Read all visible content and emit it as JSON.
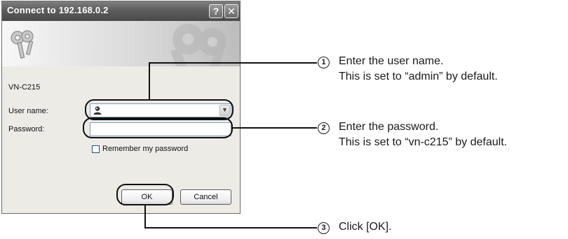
{
  "dialog": {
    "title": "Connect to 192.168.0.2",
    "help_glyph": "?",
    "close_glyph": "✕",
    "server_name": "VN-C215",
    "user_label": "User name:",
    "user_value": "",
    "password_label": "Password:",
    "password_value": "",
    "remember_label": "Remember my password",
    "remember_checked": false,
    "ok_label": "OK",
    "cancel_label": "Cancel"
  },
  "icons": {
    "banner": "keys-icon",
    "user": "user-icon",
    "dropdown": "chevron-down-icon"
  },
  "callouts": [
    {
      "number": "1",
      "line1": "Enter the user name.",
      "line2": "This is set to “admin” by default."
    },
    {
      "number": "2",
      "line1": "Enter the password.",
      "line2": "This is set to “vn-c215” by default."
    },
    {
      "number": "3",
      "line1": "Click [OK].",
      "line2": ""
    }
  ]
}
